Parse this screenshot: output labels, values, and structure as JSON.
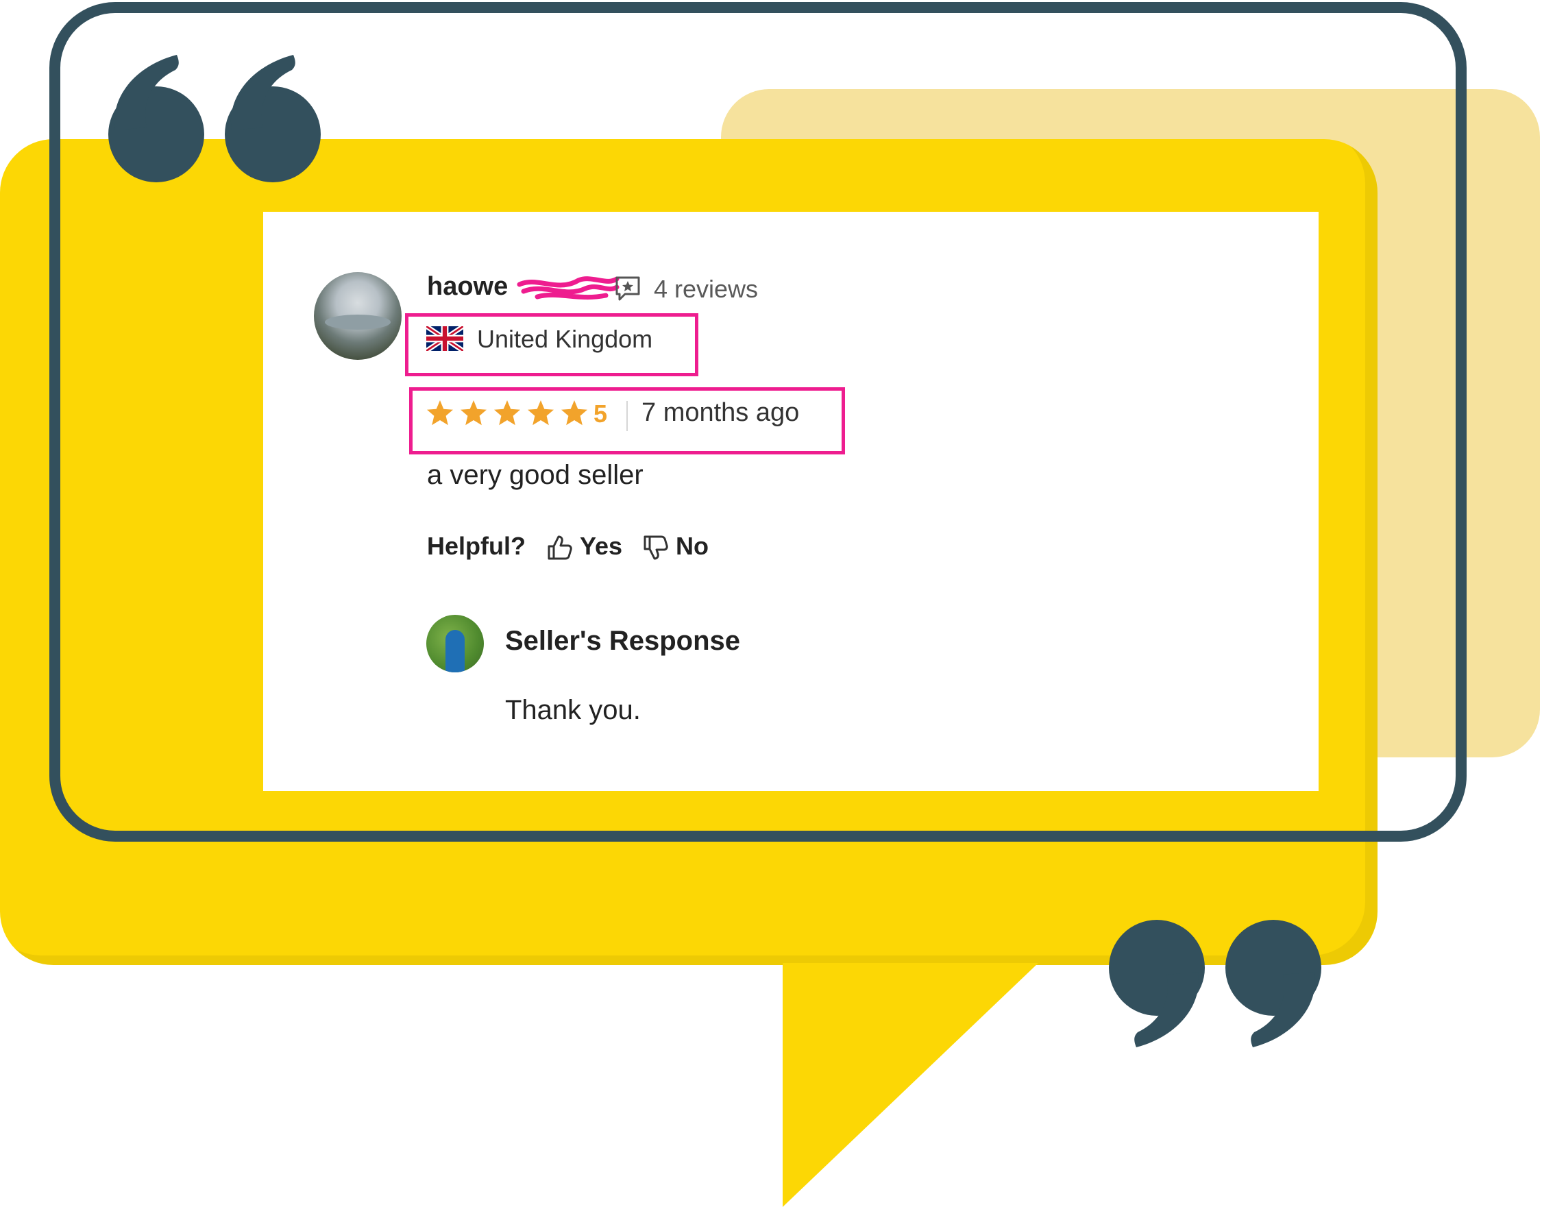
{
  "review": {
    "username": "haowe",
    "reviews_count": "4 reviews",
    "country": "United Kingdom",
    "rating": "5",
    "rating_stars": 5,
    "date": "7 months ago",
    "text": "a very good seller",
    "helpful_label": "Helpful?",
    "yes_label": "Yes",
    "no_label": "No"
  },
  "seller_response": {
    "title": "Seller's Response",
    "text": "Thank you."
  },
  "colors": {
    "highlight": "#ee1d8f",
    "star": "#f2a32b",
    "bubble_yellow": "#fcd705",
    "frame": "#33505d"
  },
  "icons": [
    "quote-open-icon",
    "quote-close-icon",
    "review-bubble-icon",
    "uk-flag-icon",
    "star-icon",
    "thumbs-up-icon",
    "thumbs-down-icon"
  ]
}
